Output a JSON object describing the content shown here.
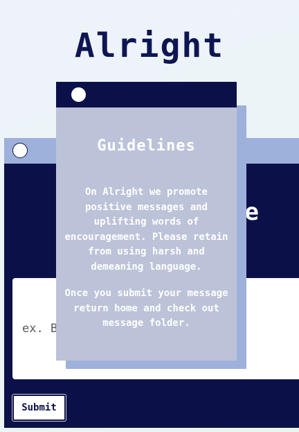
{
  "app": {
    "title": "Alright"
  },
  "composer": {
    "heading_fragment": "e",
    "input_placeholder": "ex. Be",
    "submit_label": "Submit"
  },
  "guidelines": {
    "heading": "Guidelines",
    "paragraph_1": "On Alright we promote positive messages and uplifting words of encouragement. Please retain from using harsh and demeaning language.",
    "paragraph_2": "Once you submit your message return home and check out message folder."
  },
  "colors": {
    "navy": "#0b1148",
    "periwinkle": "#9eb1da",
    "panel_gray": "#bcc3d8",
    "background": "#eef3fb"
  }
}
